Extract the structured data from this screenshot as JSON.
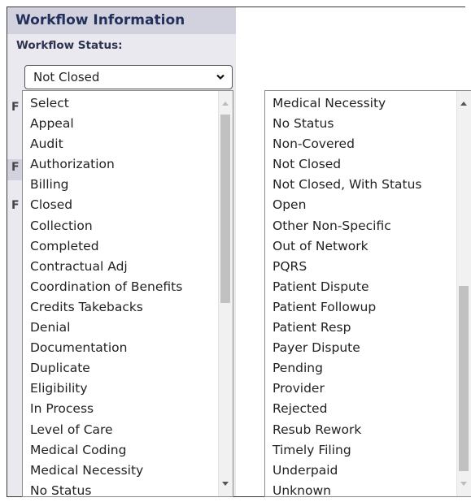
{
  "workflow": {
    "header_title": "Workflow Information",
    "status_label": "Workflow Status:",
    "selected_status": "Not Closed"
  },
  "peek_letters": [
    "F",
    "F",
    "F"
  ],
  "left_list": {
    "items": [
      "Select",
      "Appeal",
      "Audit",
      "Authorization",
      "Billing",
      "Closed",
      "Collection",
      "Completed",
      "Contractual Adj",
      "Coordination of Benefits",
      "Credits Takebacks",
      "Denial",
      "Documentation",
      "Duplicate",
      "Eligibility",
      "In Process",
      "Level of Care",
      "Medical Coding",
      "Medical Necessity",
      "No Status"
    ]
  },
  "right_list": {
    "items": [
      "Medical Necessity",
      "No Status",
      "Non-Covered",
      "Not Closed",
      "Not Closed, With Status",
      "Open",
      "Other Non-Specific",
      "Out of Network",
      "PQRS",
      "Patient Dispute",
      "Patient Followup",
      "Patient Resp",
      "Payer Dispute",
      "Pending",
      "Provider",
      "Rejected",
      "Resub Rework",
      "Timely Filing",
      "Underpaid",
      "Unknown"
    ]
  },
  "colors": {
    "panel_bg": "#e9e9ef",
    "header_bg": "#d2d2df",
    "header_text": "#23305c"
  }
}
